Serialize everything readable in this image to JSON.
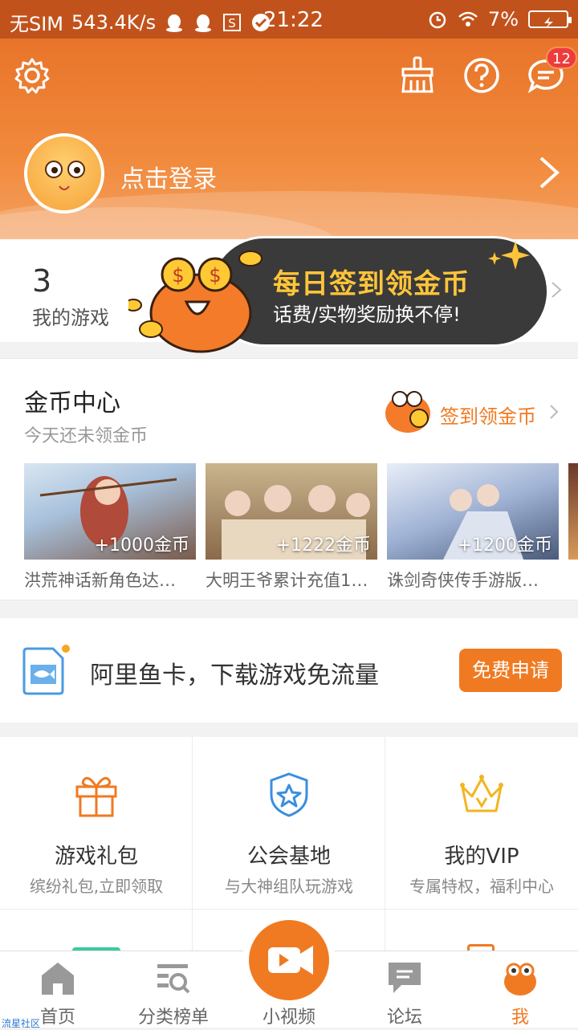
{
  "status_bar": {
    "carrier": "无SIM",
    "speed": "543.4K/s",
    "time": "21:22",
    "battery": "7%"
  },
  "header": {
    "login_text": "点击登录",
    "message_badge": "12",
    "icons": [
      "settings-icon",
      "broom-icon",
      "help-icon",
      "message-icon"
    ]
  },
  "my_games": {
    "count": "3",
    "label": "我的游戏"
  },
  "promo_banner": {
    "title": "每日签到领金币",
    "subtitle": "话费/实物奖励换不停!"
  },
  "coin_center": {
    "title": "金币中心",
    "subtitle": "今天还未领金币",
    "sign_label": "签到领金币",
    "cards": [
      {
        "coins": "+1000金币",
        "caption": "洪荒神话新角色达…"
      },
      {
        "coins": "+1222金币",
        "caption": "大明王爷累计充值1…"
      },
      {
        "coins": "+1200金币",
        "caption": "诛剑奇侠传手游版…"
      }
    ]
  },
  "fish_card": {
    "text": "阿里鱼卡，下载游戏免流量",
    "button": "免费申请"
  },
  "features": [
    {
      "title": "游戏礼包",
      "subtitle": "缤纷礼包,立即领取"
    },
    {
      "title": "公会基地",
      "subtitle": "与大神组队玩游戏"
    },
    {
      "title": "我的VIP",
      "subtitle": "专属特权，福利中心"
    }
  ],
  "tabbar": {
    "tabs": [
      {
        "label": "首页"
      },
      {
        "label": "分类榜单"
      },
      {
        "label": "小视频"
      },
      {
        "label": "论坛"
      },
      {
        "label": "我"
      }
    ],
    "active_color": "#f07a22"
  },
  "watermark": "流星社区",
  "colors": {
    "accent": "#f07a22",
    "header": "#e8742a",
    "dark_pill": "#3a3a3a",
    "gold": "#ffc53a"
  }
}
